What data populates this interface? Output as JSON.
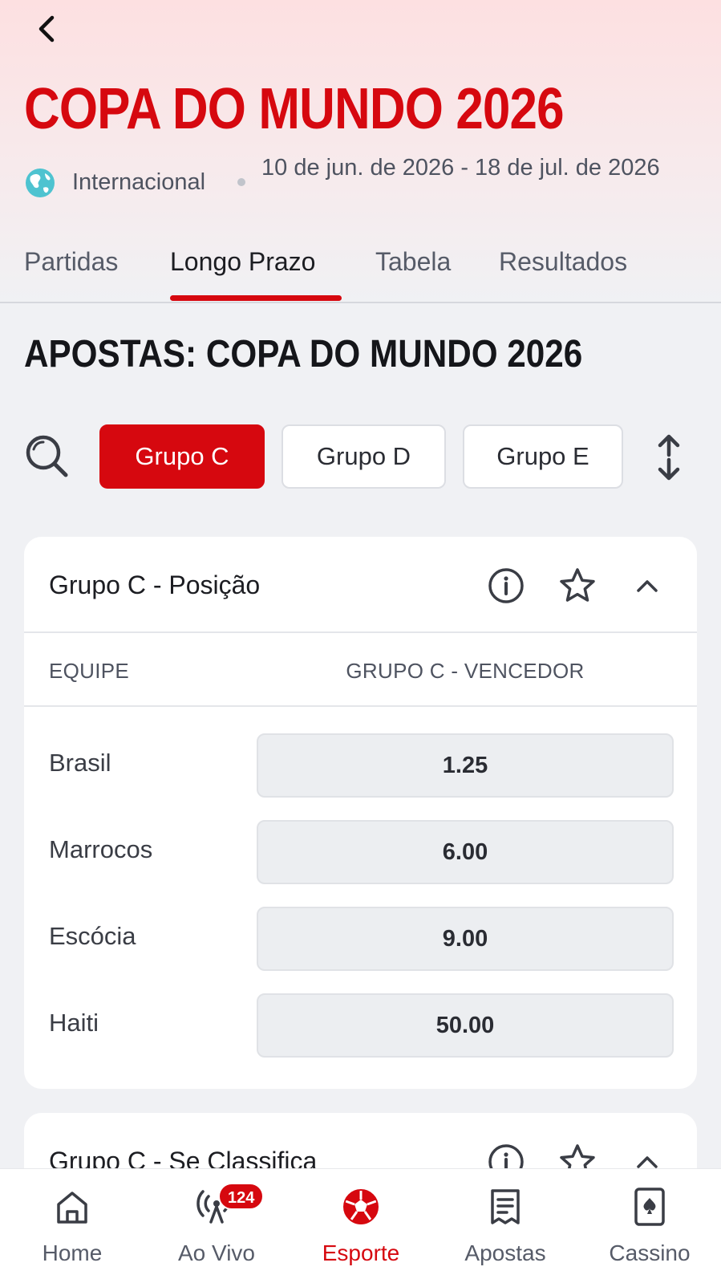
{
  "header": {
    "title": "COPA DO MUNDO 2026",
    "region": "Internacional",
    "dates": "10 de jun. de 2026 - 18 de jul. de 2026",
    "back_icon": "chevron-left-icon",
    "globe_icon": "globe-icon"
  },
  "tabs": [
    {
      "label": "Partidas",
      "active": false
    },
    {
      "label": "Longo Prazo",
      "active": true
    },
    {
      "label": "Tabela",
      "active": false
    },
    {
      "label": "Resultados",
      "active": false
    }
  ],
  "page_title": "APOSTAS: COPA DO MUNDO 2026",
  "filters": {
    "search_icon": "search-icon",
    "chips": [
      {
        "label": "Grupo C",
        "active": true
      },
      {
        "label": "Grupo D",
        "active": false
      },
      {
        "label": "Grupo E",
        "active": false
      }
    ],
    "sort_icon": "sort-arrows-icon"
  },
  "market_card": {
    "title": "Grupo C - Posição",
    "column_team": "EQUIPE",
    "column_market": "GRUPO C - VENCEDOR",
    "rows": [
      {
        "team": "Brasil",
        "odd": "1.25"
      },
      {
        "team": "Marrocos",
        "odd": "6.00"
      },
      {
        "team": "Escócia",
        "odd": "9.00"
      },
      {
        "team": "Haiti",
        "odd": "50.00"
      }
    ]
  },
  "market_card_2": {
    "title": "Grupo C - Se Classifica"
  },
  "bottom_nav": {
    "items": [
      {
        "label": "Home",
        "icon": "home-icon",
        "active": false
      },
      {
        "label": "Ao Vivo",
        "icon": "live-broadcast-icon",
        "active": false
      },
      {
        "label": "Esporte",
        "icon": "soccer-ball-icon",
        "active": true
      },
      {
        "label": "Apostas",
        "icon": "bet-slip-icon",
        "active": false
      },
      {
        "label": "Cassino",
        "icon": "playing-card-icon",
        "active": false
      }
    ],
    "live_badge": "124"
  },
  "colors": {
    "brand_red": "#d6080f",
    "background": "#f0f1f4"
  }
}
